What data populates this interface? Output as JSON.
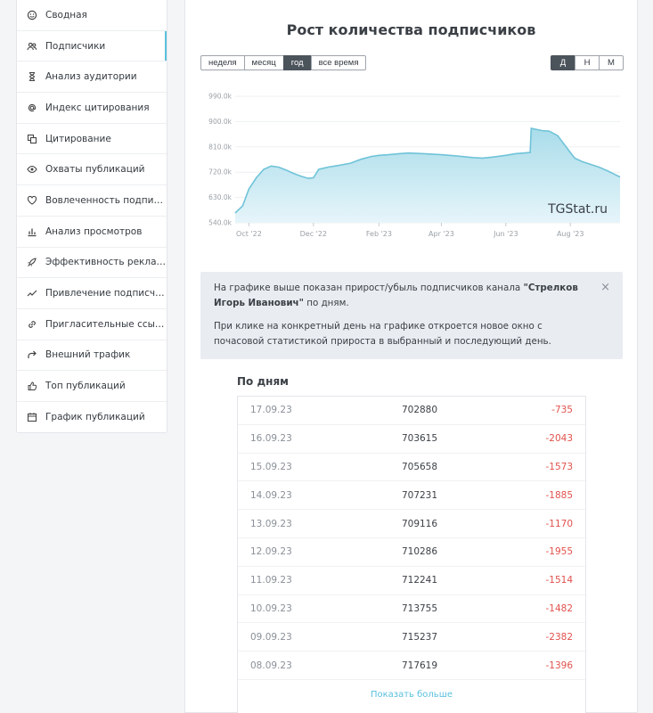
{
  "sidebar": {
    "items": [
      {
        "label": "Сводная",
        "icon": "smile-icon",
        "name": "sidebar-item-summary"
      },
      {
        "label": "Подписчики",
        "icon": "users-icon",
        "name": "sidebar-item-subscribers",
        "active": true
      },
      {
        "label": "Анализ аудитории",
        "icon": "hourglass-icon",
        "name": "sidebar-item-audience"
      },
      {
        "label": "Индекс цитирования",
        "icon": "at-icon",
        "name": "sidebar-item-citation-index"
      },
      {
        "label": "Цитирование",
        "icon": "quote-copy-icon",
        "name": "sidebar-item-citations"
      },
      {
        "label": "Охваты публикаций",
        "icon": "eye-icon",
        "name": "sidebar-item-reach"
      },
      {
        "label": "Вовлеченность подписчиков",
        "icon": "heart-icon",
        "name": "sidebar-item-engagement"
      },
      {
        "label": "Анализ просмотров",
        "icon": "bar-chart-icon",
        "name": "sidebar-item-views"
      },
      {
        "label": "Эффективность рекламы",
        "icon": "rocket-icon",
        "name": "sidebar-item-ads"
      },
      {
        "label": "Привлечение подписчиков",
        "icon": "trend-icon",
        "name": "sidebar-item-acquisition"
      },
      {
        "label": "Пригласительные ссылки",
        "icon": "link-icon",
        "name": "sidebar-item-invite-links"
      },
      {
        "label": "Внешний трафик",
        "icon": "share-icon",
        "name": "sidebar-item-traffic"
      },
      {
        "label": "Топ публикаций",
        "icon": "thumbs-up-icon",
        "name": "sidebar-item-top-posts"
      },
      {
        "label": "График публикаций",
        "icon": "calendar-icon",
        "name": "sidebar-item-schedule"
      }
    ]
  },
  "main": {
    "title": "Рост количества подписчиков",
    "range_buttons": [
      {
        "label": "неделя",
        "active": false
      },
      {
        "label": "месяц",
        "active": false
      },
      {
        "label": "год",
        "active": true
      },
      {
        "label": "все время",
        "active": false
      }
    ],
    "granularity_buttons": [
      {
        "label": "Д",
        "active": true
      },
      {
        "label": "Н",
        "active": false
      },
      {
        "label": "М",
        "active": false
      }
    ],
    "alert": {
      "text1_prefix": "На графике выше показан прирост/убыль подписчиков канала ",
      "channel": "\"Стрелков Игорь Иванович\"",
      "text1_suffix": " по дням.",
      "text2": "При клике на конкретный день на графике откроется новое окно с почасовой статистикой прироста в выбранный и последующий день.",
      "close": "×"
    },
    "days_heading": "По дням",
    "days": [
      {
        "date": "17.09.23",
        "count": "702880",
        "delta": "-735"
      },
      {
        "date": "16.09.23",
        "count": "703615",
        "delta": "-2043"
      },
      {
        "date": "15.09.23",
        "count": "705658",
        "delta": "-1573"
      },
      {
        "date": "14.09.23",
        "count": "707231",
        "delta": "-1885"
      },
      {
        "date": "13.09.23",
        "count": "709116",
        "delta": "-1170"
      },
      {
        "date": "12.09.23",
        "count": "710286",
        "delta": "-1955"
      },
      {
        "date": "11.09.23",
        "count": "712241",
        "delta": "-1514"
      },
      {
        "date": "10.09.23",
        "count": "713755",
        "delta": "-1482"
      },
      {
        "date": "09.09.23",
        "count": "715237",
        "delta": "-2382"
      },
      {
        "date": "08.09.23",
        "count": "717619",
        "delta": "-1396"
      }
    ],
    "show_more": "Показать больше"
  },
  "chart_data": {
    "type": "area",
    "title": "",
    "watermark": "TGStat.ru",
    "y_ticks": [
      "540.0k",
      "630.0k",
      "720.0k",
      "810.0k",
      "900.0k",
      "990.0k"
    ],
    "y_tick_values": [
      540000,
      630000,
      720000,
      810000,
      900000,
      990000
    ],
    "ylim": [
      540000,
      990000
    ],
    "x_ticks": [
      "Oct '22",
      "Dec '22",
      "Feb '23",
      "Apr '23",
      "Jun '23",
      "Aug '23"
    ],
    "x_tick_dates": [
      "2022-10-01",
      "2022-12-01",
      "2023-02-01",
      "2023-04-01",
      "2023-06-01",
      "2023-08-01"
    ],
    "x_range": [
      "2022-09-18",
      "2023-09-17"
    ],
    "grid": true,
    "colors": {
      "line": "#6fc3d8",
      "fill_top": "#a9dcea",
      "fill_bottom": "#e6f5fa"
    },
    "series": [
      {
        "points": [
          [
            "2022-09-18",
            575000
          ],
          [
            "2022-09-25",
            600000
          ],
          [
            "2022-10-01",
            660000
          ],
          [
            "2022-10-08",
            700000
          ],
          [
            "2022-10-15",
            730000
          ],
          [
            "2022-10-22",
            742000
          ],
          [
            "2022-10-29",
            738000
          ],
          [
            "2022-11-05",
            728000
          ],
          [
            "2022-11-12",
            716000
          ],
          [
            "2022-11-19",
            706000
          ],
          [
            "2022-11-26",
            698000
          ],
          [
            "2022-12-01",
            700000
          ],
          [
            "2022-12-06",
            730000
          ],
          [
            "2022-12-15",
            738000
          ],
          [
            "2022-12-25",
            744000
          ],
          [
            "2023-01-05",
            752000
          ],
          [
            "2023-01-15",
            766000
          ],
          [
            "2023-01-25",
            776000
          ],
          [
            "2023-02-01",
            780000
          ],
          [
            "2023-02-10",
            782000
          ],
          [
            "2023-02-20",
            786000
          ],
          [
            "2023-03-01",
            788000
          ],
          [
            "2023-03-15",
            786000
          ],
          [
            "2023-04-01",
            782000
          ],
          [
            "2023-04-15",
            778000
          ],
          [
            "2023-05-01",
            772000
          ],
          [
            "2023-05-10",
            770000
          ],
          [
            "2023-05-20",
            774000
          ],
          [
            "2023-06-01",
            780000
          ],
          [
            "2023-06-10",
            786000
          ],
          [
            "2023-06-18",
            788000
          ],
          [
            "2023-06-24",
            790000
          ],
          [
            "2023-06-25",
            876000
          ],
          [
            "2023-07-05",
            868000
          ],
          [
            "2023-07-12",
            866000
          ],
          [
            "2023-07-20",
            850000
          ],
          [
            "2023-07-28",
            810000
          ],
          [
            "2023-08-05",
            770000
          ],
          [
            "2023-08-12",
            758000
          ],
          [
            "2023-08-20",
            748000
          ],
          [
            "2023-08-28",
            738000
          ],
          [
            "2023-09-05",
            725000
          ],
          [
            "2023-09-12",
            712000
          ],
          [
            "2023-09-17",
            702880
          ]
        ]
      }
    ]
  }
}
